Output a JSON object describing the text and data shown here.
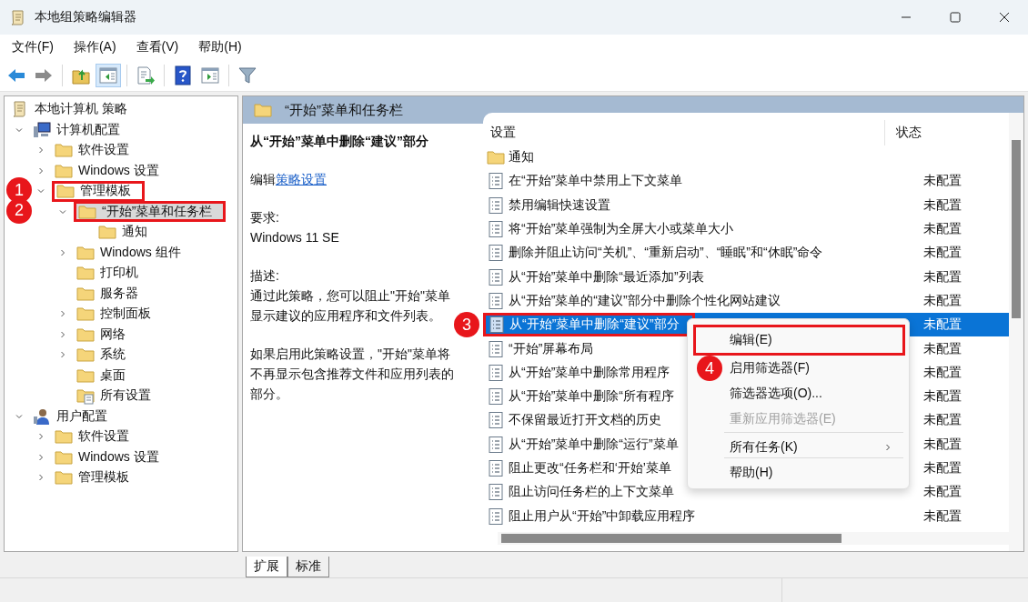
{
  "window": {
    "title": "本地组策略编辑器"
  },
  "menu": [
    "文件(F)",
    "操作(A)",
    "查看(V)",
    "帮助(H)"
  ],
  "toolbar": [
    [
      {
        "kind": "back",
        "pressed": false,
        "disabled": false
      },
      {
        "kind": "forward",
        "pressed": false,
        "disabled": true
      }
    ],
    [
      {
        "kind": "up",
        "pressed": false,
        "disabled": false
      },
      {
        "kind": "tree",
        "pressed": true,
        "disabled": false
      }
    ],
    [
      {
        "kind": "export",
        "pressed": false,
        "disabled": false
      }
    ],
    [
      {
        "kind": "help",
        "pressed": false,
        "disabled": false
      },
      {
        "kind": "panel",
        "pressed": false,
        "disabled": false
      }
    ],
    [
      {
        "kind": "filter",
        "pressed": false,
        "disabled": false
      }
    ]
  ],
  "tree": [
    {
      "label": "本地计算机 策略",
      "kind": "policy",
      "selected": false,
      "children": [
        {
          "label": "计算机配置",
          "kind": "computer",
          "expanded": true,
          "selected": false,
          "children": [
            {
              "label": "软件设置",
              "kind": "folder",
              "expanded": false,
              "selected": false
            },
            {
              "label": "Windows 设置",
              "kind": "folder",
              "expanded": false,
              "selected": false
            },
            {
              "label": "管理模板",
              "kind": "folder",
              "expanded": true,
              "selected": false,
              "callout": "1",
              "children": [
                {
                  "label": "“开始”菜单和任务栏",
                  "kind": "folder",
                  "expanded": true,
                  "selected": true,
                  "callout": "2",
                  "children": [
                    {
                      "label": "通知",
                      "kind": "folder",
                      "selected": false
                    }
                  ]
                },
                {
                  "label": "Windows 组件",
                  "kind": "folder",
                  "expanded": false,
                  "selected": false
                },
                {
                  "label": "打印机",
                  "kind": "folder",
                  "selected": false
                },
                {
                  "label": "服务器",
                  "kind": "folder",
                  "selected": false
                },
                {
                  "label": "控制面板",
                  "kind": "folder",
                  "expanded": false,
                  "selected": false
                },
                {
                  "label": "网络",
                  "kind": "folder",
                  "expanded": false,
                  "selected": false
                },
                {
                  "label": "系统",
                  "kind": "folder",
                  "expanded": false,
                  "selected": false
                },
                {
                  "label": "桌面",
                  "kind": "folder",
                  "selected": false
                },
                {
                  "label": "所有设置",
                  "kind": "settings",
                  "selected": false
                }
              ]
            }
          ]
        },
        {
          "label": "用户配置",
          "kind": "user",
          "expanded": true,
          "selected": false,
          "children": [
            {
              "label": "软件设置",
              "kind": "folder",
              "expanded": false,
              "selected": false
            },
            {
              "label": "Windows 设置",
              "kind": "folder",
              "expanded": false,
              "selected": false
            },
            {
              "label": "管理模板",
              "kind": "folder",
              "expanded": false,
              "selected": false
            }
          ]
        }
      ]
    }
  ],
  "header": {
    "title": "“开始”菜单和任务栏"
  },
  "description": {
    "title": "从“开始”菜单中删除“建议”部分",
    "edit_prefix": "编辑",
    "edit_link": "策略设置",
    "requirements_label": "要求:",
    "requirements": "Windows 11 SE",
    "description_label": "描述:",
    "paragraphs": [
      "通过此策略，您可以阻止\"开始\"菜单显示建议的应用程序和文件列表。",
      "如果启用此策略设置，\"开始\"菜单将不再显示包含推荐文件和应用列表的部分。"
    ]
  },
  "list": {
    "columns": [
      "设置",
      "状态"
    ],
    "rows": [
      {
        "kind": "folder",
        "name": "通知",
        "selected": false
      },
      {
        "kind": "policy",
        "name": "在“开始”菜单中禁用上下文菜单",
        "state": "未配置",
        "selected": false
      },
      {
        "kind": "policy",
        "name": "禁用编辑快速设置",
        "state": "未配置",
        "selected": false
      },
      {
        "kind": "policy",
        "name": "将“开始”菜单强制为全屏大小或菜单大小",
        "state": "未配置",
        "selected": false
      },
      {
        "kind": "policy",
        "name": "删除并阻止访问“关机”、“重新启动”、“睡眠”和“休眠”命令",
        "state": "未配置",
        "selected": false
      },
      {
        "kind": "policy",
        "name": "从“开始”菜单中删除“最近添加”列表",
        "state": "未配置",
        "selected": false
      },
      {
        "kind": "policy",
        "name": "从“开始”菜单的“建议”部分中删除个性化网站建议",
        "state": "未配置",
        "selected": false
      },
      {
        "kind": "policy",
        "name": "从“开始”菜单中删除“建议”部分",
        "state": "未配置",
        "selected": true,
        "callout": "3"
      },
      {
        "kind": "policy",
        "name": "“开始”屏幕布局",
        "state": "未配置",
        "selected": false
      },
      {
        "kind": "policy",
        "name": "从“开始”菜单中删除常用程序",
        "state": "未配置",
        "selected": false
      },
      {
        "kind": "policy",
        "name": "从“开始”菜单中删除“所有程序",
        "state": "未配置",
        "selected": false
      },
      {
        "kind": "policy",
        "name": "不保留最近打开文档的历史",
        "state": "未配置",
        "selected": false
      },
      {
        "kind": "policy",
        "name": "从“开始”菜单中删除“运行”菜单",
        "state": "未配置",
        "selected": false
      },
      {
        "kind": "policy",
        "name": "阻止更改“任务栏和‘开始’菜单",
        "state": "未配置",
        "selected": false
      },
      {
        "kind": "policy",
        "name": "阻止访问任务栏的上下文菜单",
        "state": "未配置",
        "selected": false
      },
      {
        "kind": "policy",
        "name": "阻止用户从“开始”中卸载应用程序",
        "state": "未配置",
        "selected": false
      }
    ]
  },
  "context_menu": [
    {
      "label": "编辑(E)",
      "disabled": false,
      "submenu": false,
      "separator_before": false,
      "callout": "4"
    },
    {
      "label": "启用筛选器(F)",
      "disabled": false,
      "submenu": false,
      "separator_before": false
    },
    {
      "label": "筛选器选项(O)...",
      "disabled": false,
      "submenu": false,
      "separator_before": false
    },
    {
      "label": "重新应用筛选器(E)",
      "disabled": true,
      "submenu": false,
      "separator_before": false
    },
    {
      "label": "所有任务(K)",
      "disabled": false,
      "submenu": true,
      "separator_before": true
    },
    {
      "label": "帮助(H)",
      "disabled": false,
      "submenu": false,
      "separator_before": true
    }
  ],
  "view_tabs": [
    {
      "label": "扩展",
      "selected": true
    },
    {
      "label": "标准",
      "selected": false
    }
  ]
}
